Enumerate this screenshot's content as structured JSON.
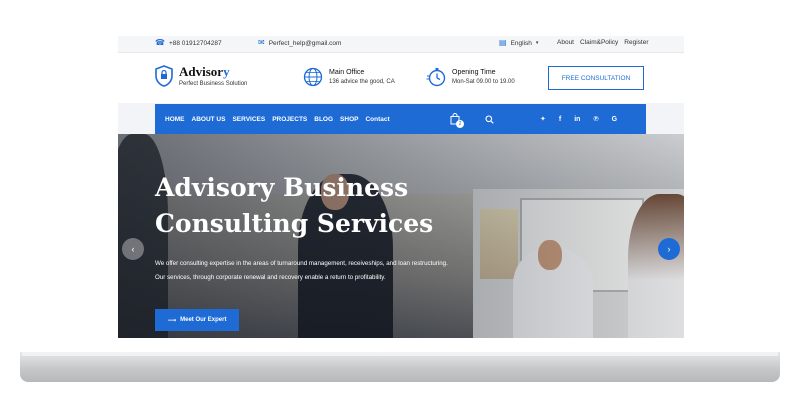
{
  "topbar": {
    "phone": "+88 01912704287",
    "email": "Perfect_help@gmail.com",
    "language": "English",
    "links": [
      "About",
      "Claim&Policy",
      "Register"
    ]
  },
  "header": {
    "brand_main": "Advisor",
    "brand_accent": "y",
    "tagline": "Perfect Business Solution",
    "office_title": "Main Office",
    "office_value": "136 advice the good, CA",
    "hours_title": "Opening Time",
    "hours_value": "Mon-Sat 09.00 to 19.00",
    "cta": "FREE CONSULTATION"
  },
  "nav": {
    "items": [
      "HOME",
      "ABOUT US",
      "SERVICES",
      "PROJECTS",
      "BLOG",
      "SHOP",
      "Contact"
    ],
    "cart_count": "2",
    "socials": [
      "twitter-icon",
      "facebook-icon",
      "linkedin-icon",
      "pinterest-icon",
      "google-icon"
    ]
  },
  "hero": {
    "title_line1": "Advisory Business",
    "title_line2": "Consulting Services",
    "description": "We offer consulting expertise in the areas of turnaround management, receiveships, and loan restructuring. Our services, through corporate renewal and recovery enable a return to profitability.",
    "button": "Meet Our Expert"
  },
  "colors": {
    "accent": "#1e6bd6"
  }
}
